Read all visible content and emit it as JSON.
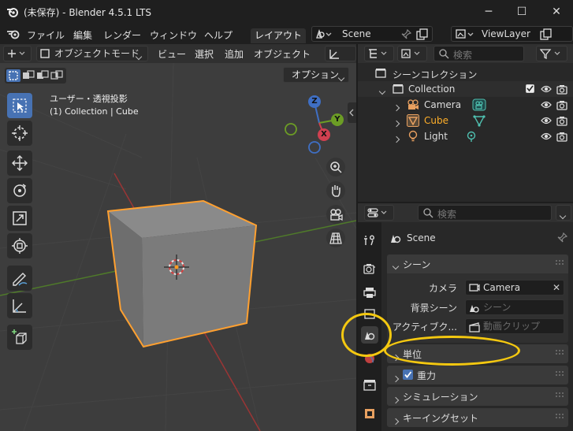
{
  "window": {
    "title": "(未保存) - Blender 4.5.1 LTS"
  },
  "menu": {
    "items": [
      "ファイル",
      "編集",
      "レンダー",
      "ウィンドウ",
      "ヘルプ"
    ],
    "workspace_tab": "レイアウト",
    "scene_name": "Scene",
    "view_layer": "ViewLayer"
  },
  "viewport": {
    "mode": "オブジェクトモード",
    "menus": [
      "ビュー",
      "選択",
      "追加",
      "オブジェクト"
    ],
    "options_label": "オプション",
    "overlay_line1": "ユーザー・透視投影",
    "overlay_line2": "(1) Collection | Cube",
    "gizmo": {
      "x": "X",
      "y": "Y",
      "z": "Z"
    }
  },
  "outliner": {
    "search_placeholder": "検索",
    "scene_collection": "シーンコレクション",
    "collection": "Collection",
    "items": [
      {
        "name": "Camera",
        "active": false
      },
      {
        "name": "Cube",
        "active": true
      },
      {
        "name": "Light",
        "active": false
      }
    ]
  },
  "properties": {
    "search_placeholder": "検索",
    "context": "Scene",
    "scene_panel": "シーン",
    "camera_label": "カメラ",
    "camera_value": "Camera",
    "bg_scene_label": "背景シーン",
    "bg_scene_placeholder": "シーン",
    "active_clip_label": "アクティブク...",
    "active_clip_placeholder": "動画クリップ",
    "panels": [
      {
        "label": "単位",
        "checkbox": false
      },
      {
        "label": "重力",
        "checkbox": true
      },
      {
        "label": "シミュレーション",
        "checkbox": false
      },
      {
        "label": "キーイングセット",
        "checkbox": false
      }
    ]
  },
  "colors": {
    "selection": "#ffa030",
    "accent": "#4772b3",
    "annotation": "#f4c810"
  }
}
